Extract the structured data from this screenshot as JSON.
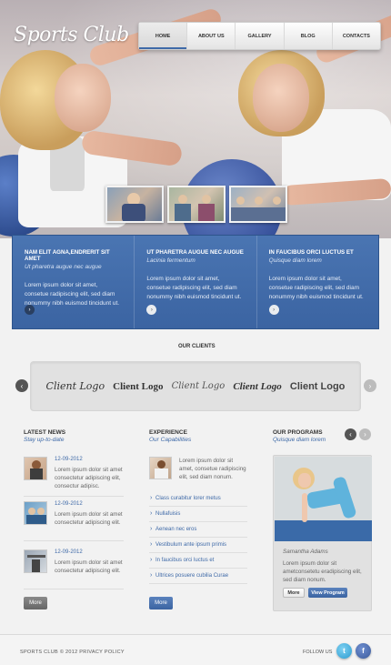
{
  "header": {
    "logo": "Sports Club",
    "nav": [
      "HOME",
      "ABOUT US",
      "GALLERY",
      "BLOG",
      "CONTACTS"
    ],
    "active_nav": "HOME"
  },
  "features": [
    {
      "title": "NAM ELIT AGNA,ENDRERIT SIT AMET",
      "subtitle": "Ut pharetra augue nec augue",
      "text": "Lorem ipsum dolor sit amet, consetue radipiscing elit, sed diam nonummy nibh euismod tincidunt ut."
    },
    {
      "title": "UT PHARETRA AUGUE NEC AUGUE",
      "subtitle": "Lacinia fermentum",
      "text": "Lorem ipsum dolor sit amet, consetue radipiscing elit, sed diam nonummy nibh euismod tincidunt ut."
    },
    {
      "title": "IN FAUCIBUS ORCI LUCTUS ET",
      "subtitle": "Quisque diam lorem",
      "text": "Lorem ipsum dolor sit amet, consetue radipiscing elit, sed diam nonummy nibh euismod tincidunt ut."
    }
  ],
  "clients": {
    "title": "OUR CLIENTS",
    "logos": [
      "Client Logo",
      "Client Logo",
      "Client Logo",
      "Client Logo",
      "Client Logo"
    ]
  },
  "news": {
    "title": "LATEST NEWS",
    "subtitle": "Stay up-to-date",
    "items": [
      {
        "date": "12-09-2012",
        "text": "Lorem ipsum dolor sit amet consectetur adipiscing elit, consectur adipisc."
      },
      {
        "date": "12-09-2012",
        "text": "Lorem ipsum dolor sit amet consectetur adipiscing elit."
      },
      {
        "date": "12-09-2012",
        "text": "Lorem ipsum dolor sit amet consectetur adipiscing elit."
      }
    ],
    "more": "More"
  },
  "experience": {
    "title": "EXPERIENCE",
    "subtitle": "Our Capabilities",
    "text": "Lorem ipsum dolor sit amet, consetue radipiscing elit, sed diam nonum.",
    "list": [
      "Class curabitur lorer metus",
      "Nullafuisis",
      "Aenean nec eros",
      "Vestibulum ante ipsum primis",
      "In faucibus orci luctus et",
      "Ultrices posuere cubilia Curae"
    ],
    "more": "More"
  },
  "programs": {
    "title": "OUR PROGRAMS",
    "subtitle": "Quisque diam lorem",
    "name": "Samantha Adams",
    "text": "Lorem ipsum dolor sit ametconsetetu eradipiscing elit, sed diam nonum.",
    "more": "More",
    "view": "View Program"
  },
  "footer": {
    "copyright": "SPORTS CLUB © 2012 PRIVACY POLICY",
    "follow": "FOLLOW US"
  },
  "colors": {
    "accent": "#3f6aa8",
    "band": "#4470ae"
  }
}
